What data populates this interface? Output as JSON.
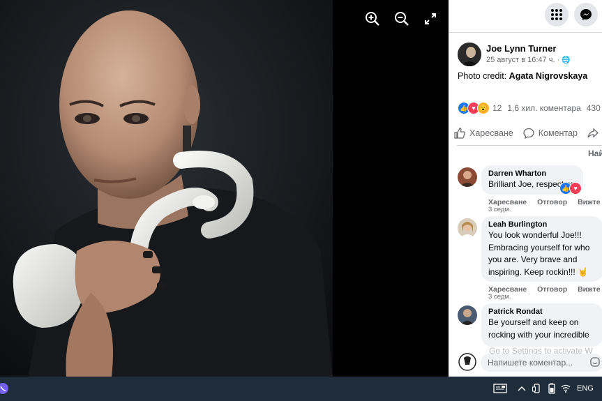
{
  "viewer": {
    "zoom_in_icon": "zoom-in-icon",
    "zoom_out_icon": "zoom-out-icon",
    "fullscreen_icon": "fullscreen-icon"
  },
  "topbar": {
    "menu_icon": "grid-menu-icon",
    "messenger_icon": "messenger-icon"
  },
  "post": {
    "author": "Joe Lynn Turner",
    "date": "25 август в 16:47 ч. ·",
    "caption_prefix": "Photo credit:",
    "caption_name": "Agata Nigrovskaya",
    "reaction_count": "12",
    "comment_count": "1,6 хил. коментара",
    "share_count": "430"
  },
  "actions": {
    "like_label": "Харесване",
    "comment_label": "Коментар"
  },
  "sort_label": "Най",
  "comments": [
    {
      "name": "Darren Wharton",
      "text": "Brilliant Joe, respect. x",
      "like": "Харесване",
      "reply": "Отговор",
      "more": "Вижте п",
      "time": "3 седм."
    },
    {
      "name": "Leah Burlington",
      "text": "You look wonderful Joe!!! Embracing yourself for who you are. Very brave and inspiring. Keep rockin!!! 🤘",
      "like": "Харесване",
      "reply": "Отговор",
      "more": "Вижте п",
      "time": "3 седм."
    },
    {
      "name": "Patrick Rondat",
      "text": "Be yourself and keep on rocking with your incredible"
    }
  ],
  "watermark": "Go to Settings to activate W",
  "composer": {
    "placeholder": "Напишете коментар..."
  },
  "taskbar": {
    "language": "ENG"
  }
}
